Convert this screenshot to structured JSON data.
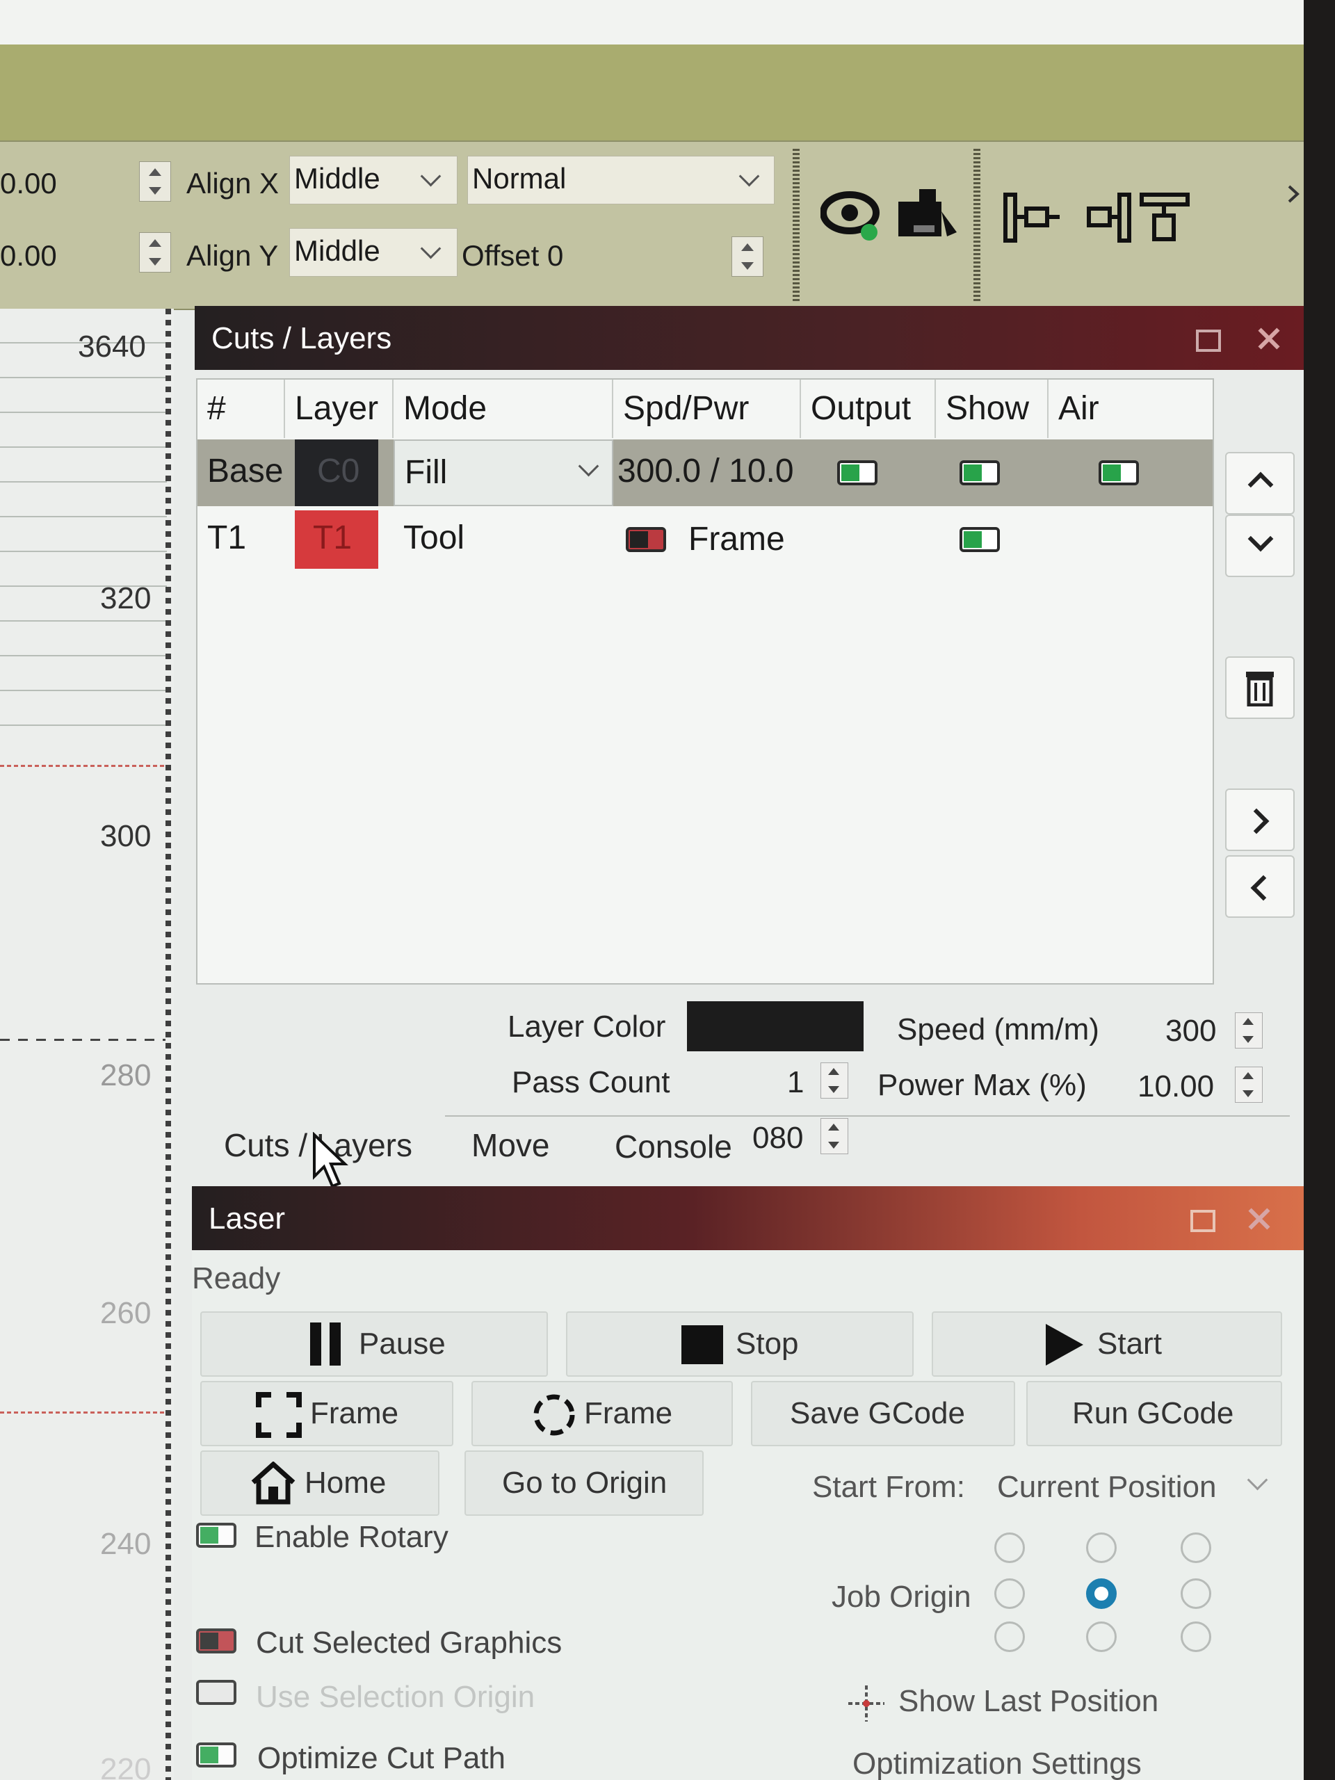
{
  "toolbar": {
    "x_value": "0.00",
    "y_value": "0.00",
    "align_x_label": "Align X",
    "align_x_value": "Middle",
    "align_y_label": "Align Y",
    "align_y_value": "Middle",
    "mode_value": "Normal",
    "offset_label": "Offset 0"
  },
  "ruler": {
    "labels": [
      "3640",
      "320",
      "300",
      "280",
      "260",
      "240",
      "220"
    ]
  },
  "cuts_panel": {
    "title": "Cuts / Layers",
    "columns": [
      "#",
      "Layer",
      "Mode",
      "Spd/Pwr",
      "Output",
      "Show",
      "Air"
    ],
    "rows": [
      {
        "num": "Base",
        "layer": "C0",
        "layer_color": "#232427",
        "mode": "Fill",
        "spd_pwr": "300.0 / 10.0",
        "output": "on",
        "show": "on",
        "air": "on"
      },
      {
        "num": "T1",
        "layer": "T1",
        "layer_color": "#d63a3d",
        "mode": "Tool",
        "spd_pwr": "Frame",
        "show": "on"
      }
    ],
    "layer_color_label": "Layer Color",
    "layer_color_value": "#1c1c1c",
    "speed_label": "Speed (mm/m)",
    "speed_value": "300",
    "pass_count_label": "Pass Count",
    "pass_count_value": "1",
    "power_max_label": "Power Max (%)",
    "power_max_value": "10.00"
  },
  "tabs": [
    "Cuts / Layers",
    "Move",
    "Console"
  ],
  "stray_value": "080",
  "laser_panel": {
    "title": "Laser",
    "status": "Ready",
    "pause": "Pause",
    "stop": "Stop",
    "start": "Start",
    "frame_rect": "Frame",
    "frame_circle": "Frame",
    "save_gcode": "Save GCode",
    "run_gcode": "Run GCode",
    "home": "Home",
    "go_to_origin": "Go to Origin",
    "start_from_label": "Start From:",
    "start_from_value": "Current Position",
    "enable_rotary": "Enable Rotary",
    "job_origin_label": "Job Origin",
    "cut_selected": "Cut Selected Graphics",
    "use_selection_origin": "Use Selection Origin",
    "show_last_position": "Show Last Position",
    "optimize_cut_path": "Optimize Cut Path",
    "optimization_settings": "Optimization Settings"
  }
}
